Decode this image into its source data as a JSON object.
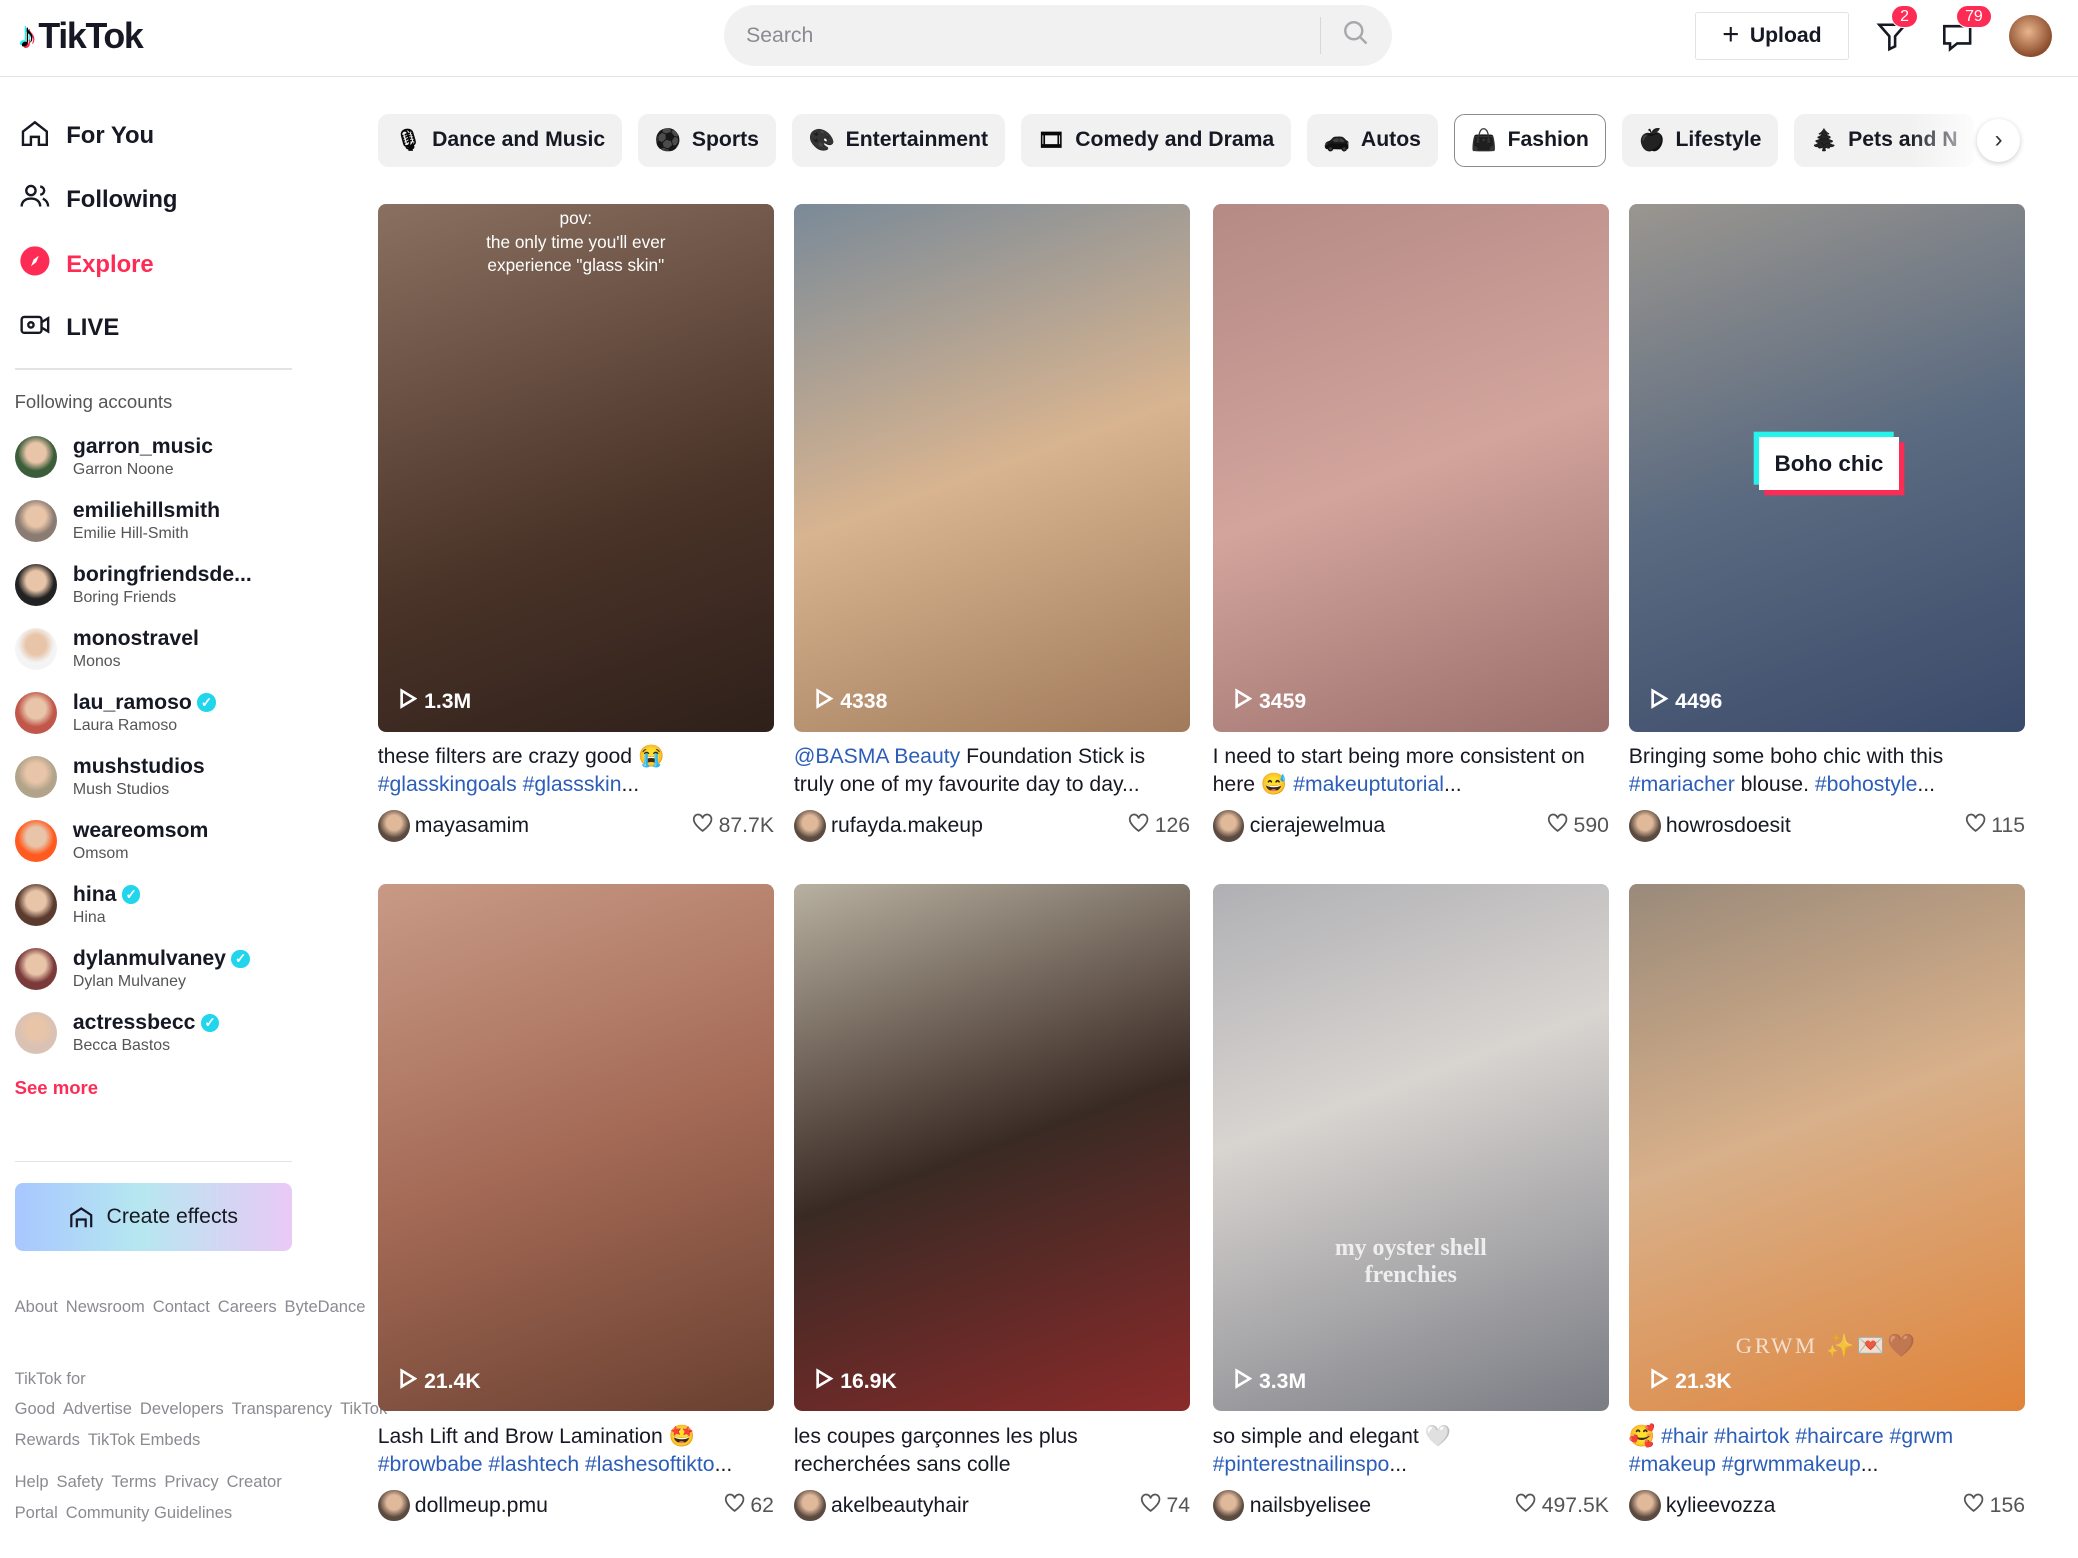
{
  "app": {
    "logo": "TikTok"
  },
  "header": {
    "search_placeholder": "Search",
    "upload_label": "Upload",
    "inbox_badge": "2",
    "messages_badge": "79"
  },
  "sidebar": {
    "nav": [
      {
        "label": "For You",
        "icon": "home-icon"
      },
      {
        "label": "Following",
        "icon": "people-icon"
      },
      {
        "label": "Explore",
        "icon": "compass-icon",
        "active": true
      },
      {
        "label": "LIVE",
        "icon": "live-icon"
      }
    ],
    "following_title": "Following accounts",
    "accounts": [
      {
        "username": "garron_music",
        "name": "Garron Noone",
        "verified": false,
        "color": "#3b5d3a"
      },
      {
        "username": "emiliehillsmith",
        "name": "Emilie Hill-Smith",
        "verified": false,
        "color": "#8a7b73"
      },
      {
        "username": "boringfriendsde...",
        "name": "Boring Friends",
        "verified": false,
        "color": "#222222"
      },
      {
        "username": "monostravel",
        "name": "Monos",
        "verified": false,
        "color": "#f4f4f4"
      },
      {
        "username": "lau_ramoso",
        "name": "Laura Ramoso",
        "verified": true,
        "color": "#c0574a"
      },
      {
        "username": "mushstudios",
        "name": "Mush Studios",
        "verified": false,
        "color": "#b2a48a"
      },
      {
        "username": "weareomsom",
        "name": "Omsom",
        "verified": false,
        "color": "#ff5a1f"
      },
      {
        "username": "hina",
        "name": "Hina",
        "verified": true,
        "color": "#5a3b2e"
      },
      {
        "username": "dylanmulvaney",
        "name": "Dylan Mulvaney",
        "verified": true,
        "color": "#7a3a3a"
      },
      {
        "username": "actressbecc",
        "name": "Becca Bastos",
        "verified": true,
        "color": "#d9c2b4"
      }
    ],
    "see_more": "See more",
    "create_effects": "Create effects",
    "footer": [
      [
        "About",
        "Newsroom",
        "Contact",
        "Careers",
        "ByteDance"
      ],
      [
        "TikTok for Good",
        "Advertise",
        "Developers",
        "Transparency",
        "TikTok Rewards",
        "TikTok Embeds"
      ],
      [
        "Help",
        "Safety",
        "Terms",
        "Privacy",
        "Creator Portal",
        "Community Guidelines"
      ]
    ]
  },
  "categories": [
    {
      "label": "Dance and Music",
      "icon": "microphone-icon"
    },
    {
      "label": "Sports",
      "icon": "ball-icon"
    },
    {
      "label": "Entertainment",
      "icon": "palette-icon"
    },
    {
      "label": "Comedy and Drama",
      "icon": "film-reel-icon"
    },
    {
      "label": "Autos",
      "icon": "car-icon"
    },
    {
      "label": "Fashion",
      "icon": "bag-icon",
      "selected": true
    },
    {
      "label": "Lifestyle",
      "icon": "apple-icon"
    },
    {
      "label": "Pets and N",
      "icon": "tree-icon"
    }
  ],
  "videos": [
    {
      "views": "1.3M",
      "overlay": "pov:\nthe only time you'll ever\nexperience \"glass skin\"",
      "caption": [
        [
          "these filters are crazy good 😭 ",
          false
        ],
        [
          "#glasskingoals #glassskin",
          true
        ],
        [
          "...",
          false
        ]
      ],
      "user": "mayasamim",
      "likes": "87.7K",
      "bg": "linear-gradient(160deg,#8a7060,#4a3328 60%,#2e201a)"
    },
    {
      "views": "4338",
      "caption": [
        [
          "@BASMA Beauty",
          true
        ],
        [
          " Foundation Stick is truly one of my favourite day to day...",
          false
        ]
      ],
      "user": "rufayda.makeup",
      "likes": "126",
      "bg": "linear-gradient(160deg,#7a8a98,#d8b490 50%,#a07a5a)"
    },
    {
      "views": "3459",
      "caption": [
        [
          "I need to start being more consistent on here 😅 ",
          false
        ],
        [
          "#makeuptutorial",
          true
        ],
        [
          "...",
          false
        ]
      ],
      "user": "cierajewelmua",
      "likes": "590",
      "bg": "linear-gradient(160deg,#b58a85,#d2a49c 50%,#9a6e6a)"
    },
    {
      "views": "4496",
      "overlay_box": "Boho chic",
      "caption": [
        [
          "Bringing some boho chic with this ",
          false
        ],
        [
          "#mariacher",
          true
        ],
        [
          " blouse. ",
          false
        ],
        [
          "#bohostyle",
          true
        ],
        [
          "...",
          false
        ]
      ],
      "user": "howrosdoesit",
      "likes": "115",
      "bg": "linear-gradient(160deg,#9a9690,#5a6a80 50%,#3a4a6a)"
    },
    {
      "views": "21.4K",
      "caption": [
        [
          "Lash Lift and Brow Lamination 🤩 ",
          false
        ],
        [
          "#browbabe #lashtech #lashesoftikto",
          true
        ],
        [
          "...",
          false
        ]
      ],
      "user": "dollmeup.pmu",
      "likes": "62",
      "bg": "linear-gradient(160deg,#c89a86,#a46a56 50%,#6a4030)"
    },
    {
      "views": "16.9K",
      "caption": [
        [
          "les coupes garçonnes les plus recherchées sans colle",
          false
        ]
      ],
      "user": "akelbeautyhair",
      "likes": "74",
      "bg": "linear-gradient(160deg,#b8b0a0,#3a2a24 50%,#8a2a2a)"
    },
    {
      "views": "3.3M",
      "overlay": "my oyster shell\nfrenchies",
      "caption": [
        [
          "so simple and elegant 🤍 ",
          false
        ],
        [
          "#pinterestnailinspo",
          true
        ],
        [
          "...",
          false
        ]
      ],
      "user": "nailsbyelisee",
      "likes": "497.5K",
      "bg": "linear-gradient(160deg,#b0b0b4,#d8d4d0 40%,#7a7c84)"
    },
    {
      "views": "21.3K",
      "overlay": "GRWM ✨💌🤎",
      "caption": [
        [
          "🥰 ",
          false
        ],
        [
          "#hair #hairtok #haircare #grwm #makeup #grwmmakeup",
          true
        ],
        [
          "...",
          false
        ]
      ],
      "user": "kylieevozza",
      "likes": "156",
      "bg": "linear-gradient(160deg,#9a8a7a,#d8b08a 45%,#e0843a)"
    }
  ],
  "colors": {
    "accent": "#fe2c55",
    "hashtag": "#2b5db9"
  }
}
